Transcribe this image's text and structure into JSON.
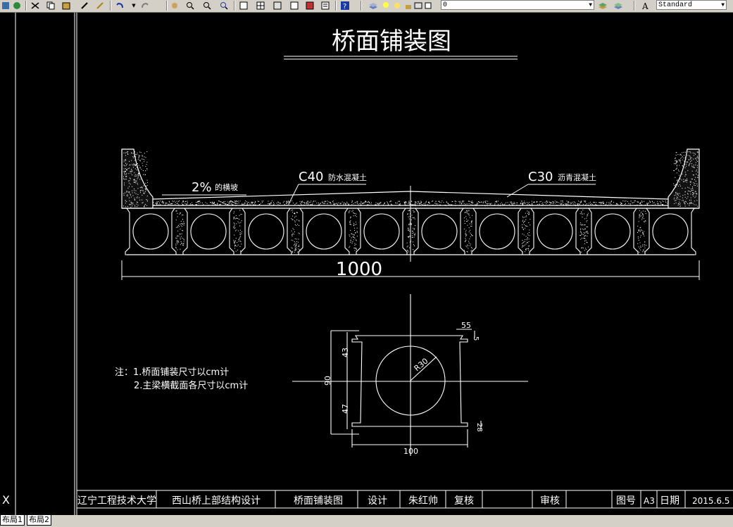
{
  "toolbar": {
    "layer_value": "0",
    "style_value": "Standard"
  },
  "drawing": {
    "title": "桥面铺装图",
    "label_c40": "C40",
    "label_c40_suffix": "防水混凝土",
    "label_c30": "C30",
    "label_c30_suffix": "沥青混凝土",
    "label_slope": "2%",
    "label_slope_suffix": "的横坡",
    "dim_total": "1000",
    "notes_line1": "注：1.桥面铺装尺寸以cm计",
    "notes_line2": "2.主梁横截面各尺寸以cm计",
    "dim_55": "55",
    "dim_5": "5",
    "dim_43": "43",
    "dim_90": "90",
    "dim_47": "47",
    "dim_r30": "R30",
    "dim_28": "28",
    "dim_100": "100"
  },
  "title_block": {
    "school": "辽宁工程技术大学",
    "project": "西山桥上部结构设计",
    "drawing_name": "桥面铺装图",
    "design_label": "设计",
    "designer": "朱红帅",
    "review_label": "复核",
    "approve_label": "审核",
    "figno_label": "图号",
    "figno": "A3",
    "date_label": "日期",
    "date": "2015.6.5"
  },
  "tabs": [
    "布局1",
    "布局2"
  ],
  "ucs_label": "X"
}
